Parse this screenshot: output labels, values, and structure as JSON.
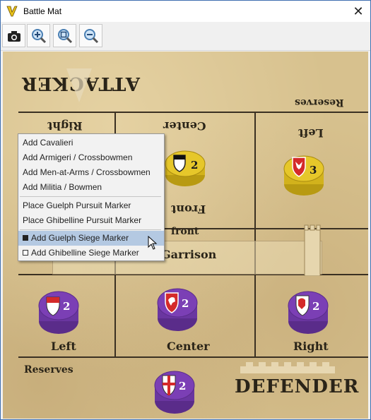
{
  "window": {
    "title": "Battle Mat",
    "close_glyph": "✕"
  },
  "toolbar": {
    "buttons": [
      {
        "name": "camera-button",
        "icon": "camera-icon"
      },
      {
        "name": "zoom-in-button",
        "icon": "zoom-in-icon"
      },
      {
        "name": "zoom-fit-button",
        "icon": "zoom-fit-icon"
      },
      {
        "name": "zoom-out-button",
        "icon": "zoom-out-icon"
      }
    ]
  },
  "board": {
    "attacker_heading": "ATTACKER",
    "defender_heading": "DEFENDER",
    "attacker_reserves": "Reserves",
    "defender_reserves": "Reserves",
    "attacker_zones": {
      "right": "Right",
      "center": "Center",
      "left": "Left"
    },
    "front_label_attacker": "Front",
    "front_label": "front",
    "garrison_label": "Garrison",
    "defender_zones": {
      "left": "Left",
      "center": "Center",
      "right": "Right"
    },
    "counters": [
      {
        "side": "attacker",
        "color": "#e6c72a",
        "value": "2",
        "emblem": "black-white-shield"
      },
      {
        "side": "attacker",
        "color": "#e6c72a",
        "value": "3",
        "emblem": "red-eagle-shield"
      },
      {
        "side": "defender",
        "color": "#7b3fb5",
        "value": "2",
        "emblem": "red-white-shield"
      },
      {
        "side": "defender",
        "color": "#7b3fb5",
        "value": "2",
        "emblem": "red-horse-shield"
      },
      {
        "side": "defender",
        "color": "#7b3fb5",
        "value": "2",
        "emblem": "red-lion-shield"
      },
      {
        "side": "defender",
        "color": "#7b3fb5",
        "value": "2",
        "emblem": "cross-shield"
      }
    ]
  },
  "context_menu": {
    "group1": [
      "Add Cavalieri",
      "Add Armigeri / Crossbowmen",
      "Add Men-at-Arms / Crossbowmen",
      "Add Militia / Bowmen"
    ],
    "group2": [
      "Place Guelph Pursuit Marker",
      "Place Ghibelline Pursuit Marker"
    ],
    "group3": [
      "Add Guelph Siege Marker",
      "Add Ghibelline Siege Marker"
    ],
    "highlighted": "Add Guelph Siege Marker"
  },
  "colors": {
    "titlebar_accent": "#3f6fb0",
    "menu_highlight": "#b4c9e2",
    "attacker": "#e6c72a",
    "defender": "#7b3fb5",
    "board": "#d7c18e"
  }
}
